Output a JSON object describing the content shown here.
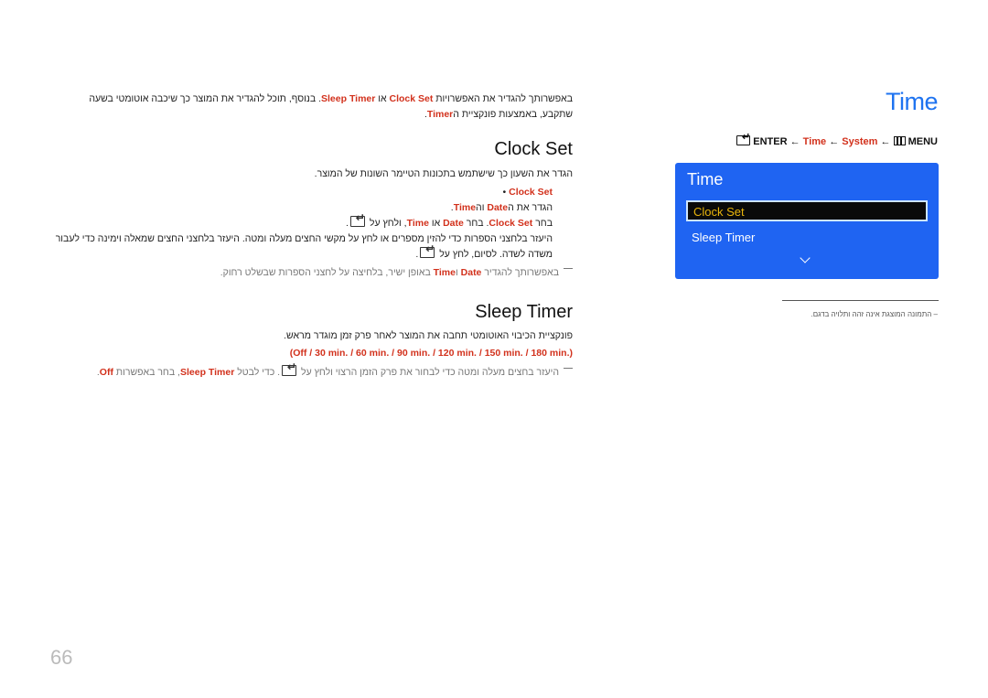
{
  "header": {
    "title": "Time",
    "nav_path": {
      "enter_label": "ENTER",
      "arrow": "←",
      "items": [
        "Time",
        "System"
      ],
      "menu_label": "MENU"
    }
  },
  "osd": {
    "title": "Time",
    "items": [
      {
        "label": "Clock Set",
        "selected": true
      },
      {
        "label": "Sleep Timer",
        "selected": false
      }
    ],
    "colors": {
      "background": "#1f64f2",
      "selected_bg": "#0a0a0a",
      "selected_text": "#e8b40c"
    }
  },
  "image_note": "– התמונה המוצגת אינה זהה ותלויה בדגם.",
  "intro": {
    "p1": "באפשרותך להגדיר את האפשרויות ",
    "k1": "Clock Set",
    "p2": " או ",
    "k2": "Sleep Timer",
    "p3": ". בנוסף, תוכל להגדיר את המוצר כך שיכבה אוטומטי בשעה שתקבע, באמצעות פונקציית ה",
    "k3": "Timer",
    "p4": "."
  },
  "clock_set": {
    "heading": "Clock Set",
    "desc": "הגדר את השעון כך שישתמש בתכונות הטיימר השונות של המוצר.",
    "bullet": "Clock Set",
    "sub1": {
      "a": "הגדר את ה",
      "k1": "Date",
      "b": " וה",
      "k2": "Time",
      "c": "."
    },
    "sub2": {
      "a": "בחר ",
      "k1": "Clock Set",
      "b": ". בחר ",
      "k2": "Date",
      "c": " או ",
      "k3": "Time",
      "d": ", ולחץ על ",
      "e": "."
    },
    "sub3": {
      "a": "היעזר בלחצני הספרות כדי להזין מספרים או לחץ על מקשי החצים מעלה ומטה. היעזר בלחצני החצים שמאלה וימינה כדי לעבור משדה לשדה. לסיום, לחץ על ",
      "b": "."
    },
    "note": {
      "a": "באפשרותך להגדיר ",
      "k1": "Date",
      "b": " ו",
      "k2": "Time",
      "c": " באופן ישיר, בלחיצה על לחצני הספרות שבשלט רחוק."
    }
  },
  "sleep_timer": {
    "heading": "Sleep Timer",
    "desc": "פונקציית הכיבוי האוטומטי תחבה את המוצר לאחר פרק זמן מוגדר מראש.",
    "options": [
      "Off",
      "30 min.",
      "60 min.",
      "90 min.",
      "120 min.",
      "150 min.",
      "180 min."
    ],
    "options_text": "(Off / 30 min. / 60 min. / 90 min. / 120 min. / 150 min. / 180 min.)",
    "note": {
      "a": "היעזר בחצים מעלה ומטה כדי לבחור את פרק הזמן הרצוי ולחץ על ",
      "b": ". כדי לבטל ",
      "k1": "Sleep Timer",
      "c": ", בחר באפשרות ",
      "k2": "Off",
      "d": "."
    }
  },
  "page_number": "66",
  "colors": {
    "accent_blue": "#1e73f0",
    "keyword_red": "#d2311c"
  }
}
